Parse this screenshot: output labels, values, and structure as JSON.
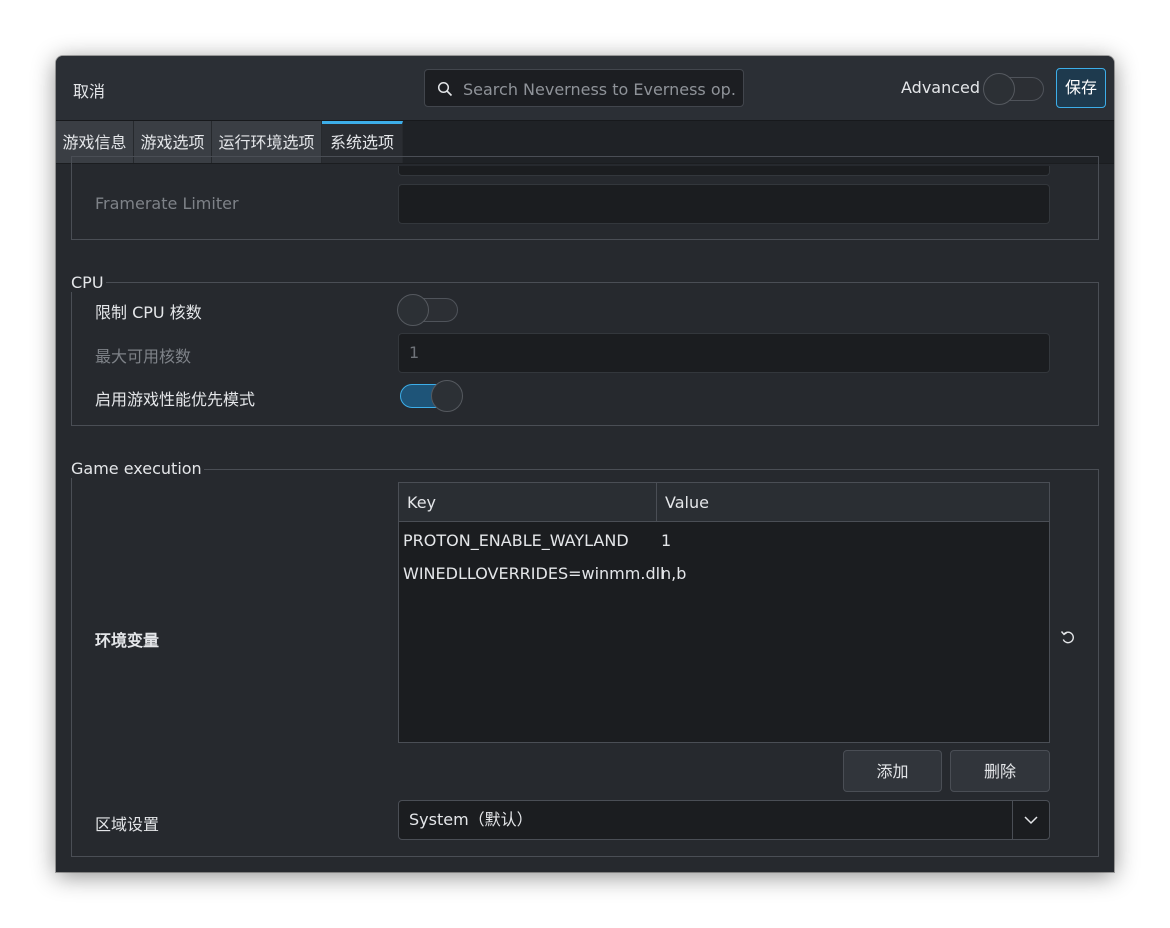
{
  "header": {
    "cancel_label": "取消",
    "search_placeholder": "Search Neverness to Everness op…",
    "advanced_label": "Advanced",
    "advanced_on": false,
    "save_label": "保存"
  },
  "tabs": [
    {
      "label": "游戏信息",
      "active": false
    },
    {
      "label": "游戏选项",
      "active": false
    },
    {
      "label": "运行环境选项",
      "active": false
    },
    {
      "label": "系统选项",
      "active": true
    }
  ],
  "display_section": {
    "framerate_label": "Framerate Limiter",
    "framerate_value": ""
  },
  "cpu_section": {
    "title": "CPU",
    "limit_cores_label": "限制 CPU 核数",
    "limit_cores_on": false,
    "max_cores_label": "最大可用核数",
    "max_cores_value": "1",
    "gamemode_label": "启用游戏性能优先模式",
    "gamemode_on": true
  },
  "execution_section": {
    "title": "Game execution",
    "env_label": "环境变量",
    "table": {
      "columns": [
        "Key",
        "Value"
      ],
      "rows": [
        {
          "key": "PROTON_ENABLE_WAYLAND",
          "value": "1"
        },
        {
          "key": "WINEDLLOVERRIDES=winmm.dll",
          "value": "n,b"
        }
      ]
    },
    "add_label": "添加",
    "delete_label": "删除",
    "locale_label": "区域设置",
    "locale_value": "System（默认）"
  },
  "colors": {
    "accent": "#3daee9",
    "window_bg": "#26292e",
    "field_bg": "#1b1d20"
  }
}
